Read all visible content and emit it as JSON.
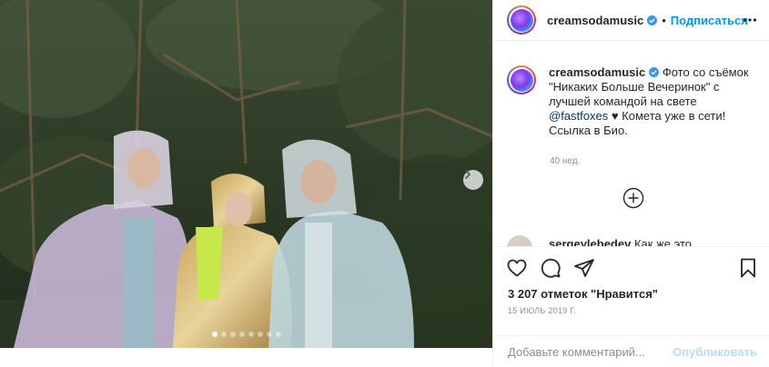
{
  "post": {
    "username": "creamsodamusic",
    "verified": true,
    "follow_label": "Подписаться",
    "separator": "•",
    "caption_part1": "Фото со съёмок \"Никаких Больше Вечеринок\" с лучшей командой на свете ",
    "caption_mention": "@fastfoxes",
    "caption_heart": "♥",
    "caption_part2": " Комета уже в сети! Ссылка в Био.",
    "time_ago": "40 нед.",
    "next_comment_user": "sergeylebedev",
    "next_comment_text": "Как же это",
    "likes_text": "3 207 отметок \"Нравится\"",
    "date": "15 ИЮЛЬ 2019 Г.",
    "comment_placeholder": "Добавьте комментарий...",
    "publish_label": "Опубликовать"
  },
  "carousel": {
    "slide_count": 8,
    "active_index": 1
  },
  "icons": {
    "more": "more-horizontal-icon",
    "load_more": "plus-circle-icon",
    "like": "heart-icon",
    "comment": "comment-icon",
    "share": "share-icon",
    "save": "bookmark-icon",
    "next": "chevron-right-icon"
  },
  "colors": {
    "accent": "#0095f6",
    "publish_disabled": "#b2dffc",
    "secondary_text": "#8e8e8e",
    "mention": "#00376b"
  }
}
